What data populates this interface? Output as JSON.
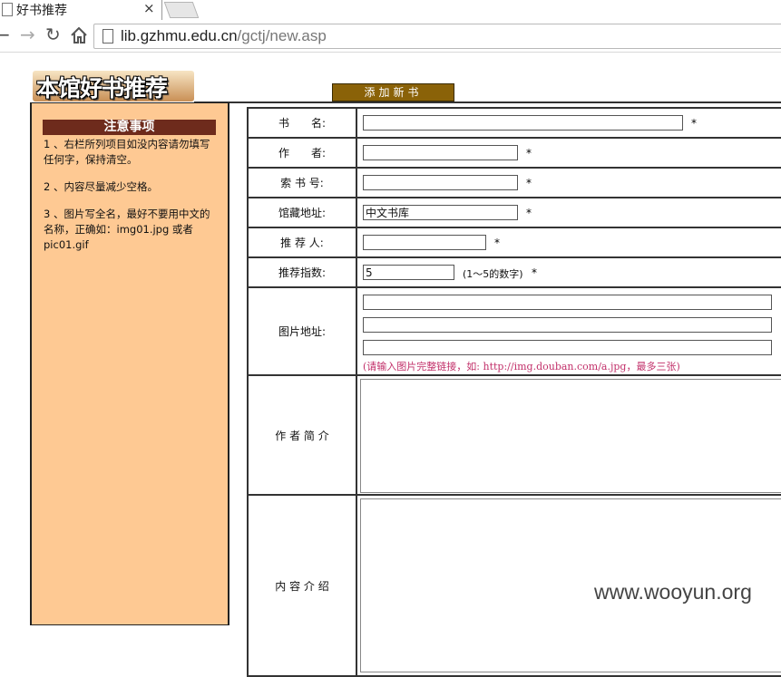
{
  "browser": {
    "tab_title": "好书推荐",
    "close_glyph": "×",
    "url_host": "lib.gzhmu.edu.cn",
    "url_path": "/gctj/new.asp",
    "icons": [
      "back-icon",
      "forward-icon",
      "reload-icon",
      "home-icon",
      "page-icon"
    ]
  },
  "header": {
    "logo_text": "本馆好书推荐",
    "add_button": "添加新书"
  },
  "sidebar": {
    "title": "注意事项",
    "notes": [
      "1 、右栏所列项目如没内容请勿填写任何字，保持清空。",
      "2 、内容尽量减少空格。",
      "3 、图片写全名，最好不要用中文的名称，正确如：img01.jpg 或者 pic01.gif"
    ]
  },
  "form": {
    "title_label": "书　　名:",
    "author_label": "作　　者:",
    "callno_label": "索 书 号:",
    "location_label": "馆藏地址:",
    "location_value": "中文书库",
    "recommender_label": "推 荐 人:",
    "rating_label": "推荐指数:",
    "rating_value": "5",
    "rating_hint": "(1～5的数字)",
    "image_label": "图片地址:",
    "image_hint": "(请输入图片完整链接，如: http://img.douban.com/a.jpg，最多三张)",
    "author_intro_label": "作 者 简 介",
    "content_intro_label": "内 容 介 绍",
    "required_mark": "*"
  },
  "watermark": "www.wooyun.org"
}
